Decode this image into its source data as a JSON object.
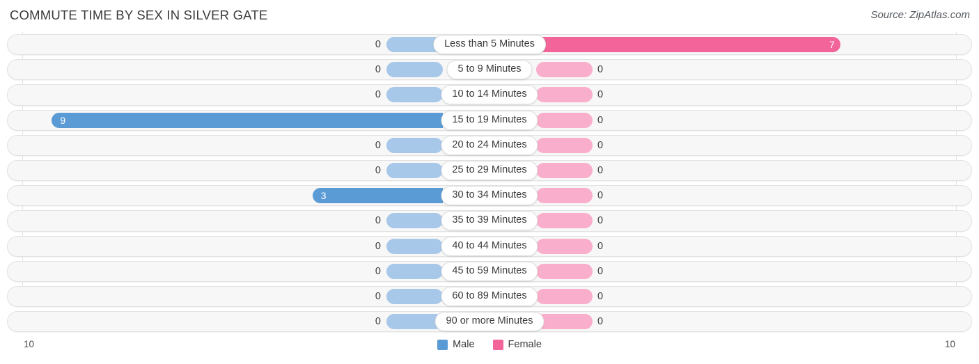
{
  "header": {
    "title": "COMMUTE TIME BY SEX IN SILVER GATE",
    "source": "Source: ZipAtlas.com"
  },
  "axis": {
    "left_label": "10",
    "right_label": "10"
  },
  "legend": {
    "items": [
      {
        "label": "Male",
        "color": "#5b9bd5"
      },
      {
        "label": "Female",
        "color": "#f2649a"
      }
    ]
  },
  "colors": {
    "male": "#5b9bd5",
    "male_zero": "#a8c8ea",
    "female": "#f2649a",
    "female_zero": "#f9aecb",
    "track": "#f7f7f7",
    "track_border": "#e2e2e2"
  },
  "chart_data": {
    "type": "bar",
    "subtype": "diverging-bidirectional",
    "title": "COMMUTE TIME BY SEX IN SILVER GATE",
    "source": "Source: ZipAtlas.com",
    "xlabel": "",
    "ylabel": "",
    "xlim": [
      10,
      10
    ],
    "axis_max_left": 10,
    "axis_max_right": 10,
    "grid": true,
    "legend_position": "bottom-center",
    "categories": [
      "Less than 5 Minutes",
      "5 to 9 Minutes",
      "10 to 14 Minutes",
      "15 to 19 Minutes",
      "20 to 24 Minutes",
      "25 to 29 Minutes",
      "30 to 34 Minutes",
      "35 to 39 Minutes",
      "40 to 44 Minutes",
      "45 to 59 Minutes",
      "60 to 89 Minutes",
      "90 or more Minutes"
    ],
    "series": [
      {
        "name": "Male",
        "color": "#5b9bd5",
        "direction": "left",
        "values": [
          0,
          0,
          0,
          9,
          0,
          0,
          3,
          0,
          0,
          0,
          0,
          0
        ]
      },
      {
        "name": "Female",
        "color": "#f2649a",
        "direction": "right",
        "values": [
          7,
          0,
          0,
          0,
          0,
          0,
          0,
          0,
          0,
          0,
          0,
          0
        ]
      }
    ]
  },
  "rows": [
    {
      "label": "Less than 5 Minutes",
      "male": "0",
      "female": "7"
    },
    {
      "label": "5 to 9 Minutes",
      "male": "0",
      "female": "0"
    },
    {
      "label": "10 to 14 Minutes",
      "male": "0",
      "female": "0"
    },
    {
      "label": "15 to 19 Minutes",
      "male": "9",
      "female": "0"
    },
    {
      "label": "20 to 24 Minutes",
      "male": "0",
      "female": "0"
    },
    {
      "label": "25 to 29 Minutes",
      "male": "0",
      "female": "0"
    },
    {
      "label": "30 to 34 Minutes",
      "male": "3",
      "female": "0"
    },
    {
      "label": "35 to 39 Minutes",
      "male": "0",
      "female": "0"
    },
    {
      "label": "40 to 44 Minutes",
      "male": "0",
      "female": "0"
    },
    {
      "label": "45 to 59 Minutes",
      "male": "0",
      "female": "0"
    },
    {
      "label": "60 to 89 Minutes",
      "male": "0",
      "female": "0"
    },
    {
      "label": "90 or more Minutes",
      "male": "0",
      "female": "0"
    }
  ]
}
